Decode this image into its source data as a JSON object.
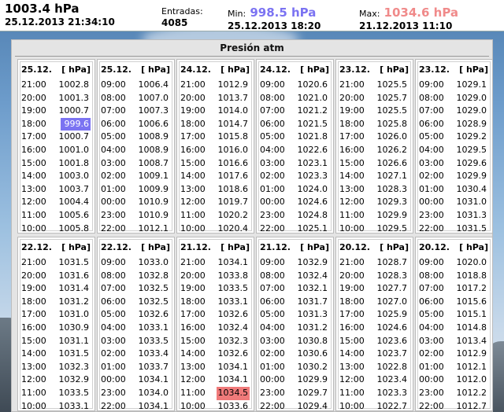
{
  "header": {
    "current_value": "1003.4 hPa",
    "current_date": "25.12.2013 21:34:10",
    "entradas_label": "Entradas:",
    "entradas_count": "4085",
    "min_label": "Min:",
    "min_value": "998.5 hPa",
    "min_date": "25.12.2013 18:20",
    "max_label": "Max:",
    "max_value": "1034.6 hPa",
    "max_date": "21.12.2013 11:10"
  },
  "colors": {
    "min": "#7b73f2",
    "max": "#f07a7a"
  },
  "panel": {
    "title": "Presión atm",
    "days": [
      {
        "date": "25.12.",
        "unit": "[ hPa]",
        "rows": [
          [
            "21:00",
            "1002.8"
          ],
          [
            "20:00",
            "1001.3"
          ],
          [
            "19:00",
            "1000.7"
          ],
          [
            "18:00",
            "999.6",
            "min"
          ],
          [
            "17:00",
            "1000.7"
          ],
          [
            "16:00",
            "1001.0"
          ],
          [
            "15:00",
            "1001.8"
          ],
          [
            "14:00",
            "1003.0"
          ],
          [
            "13:00",
            "1003.7"
          ],
          [
            "12:00",
            "1004.4"
          ],
          [
            "11:00",
            "1005.6"
          ],
          [
            "10:00",
            "1005.8"
          ]
        ]
      },
      {
        "date": "25.12.",
        "unit": "[ hPa]",
        "rows": [
          [
            "09:00",
            "1006.4"
          ],
          [
            "08:00",
            "1007.0"
          ],
          [
            "07:00",
            "1007.3"
          ],
          [
            "06:00",
            "1006.6"
          ],
          [
            "05:00",
            "1008.9"
          ],
          [
            "04:00",
            "1008.9"
          ],
          [
            "03:00",
            "1008.7"
          ],
          [
            "02:00",
            "1009.1"
          ],
          [
            "01:00",
            "1009.9"
          ],
          [
            "00:00",
            "1010.9"
          ],
          [
            "23:00",
            "1010.9"
          ],
          [
            "22:00",
            "1012.1"
          ]
        ]
      },
      {
        "date": "24.12.",
        "unit": "[ hPa]",
        "rows": [
          [
            "21:00",
            "1012.9"
          ],
          [
            "20:00",
            "1013.7"
          ],
          [
            "19:00",
            "1014.0"
          ],
          [
            "18:00",
            "1014.7"
          ],
          [
            "17:00",
            "1015.8"
          ],
          [
            "16:00",
            "1016.0"
          ],
          [
            "15:00",
            "1016.6"
          ],
          [
            "14:00",
            "1017.6"
          ],
          [
            "13:00",
            "1018.6"
          ],
          [
            "12:00",
            "1019.7"
          ],
          [
            "11:00",
            "1020.2"
          ],
          [
            "10:00",
            "1020.4"
          ]
        ]
      },
      {
        "date": "24.12.",
        "unit": "[ hPa]",
        "rows": [
          [
            "09:00",
            "1020.6"
          ],
          [
            "08:00",
            "1021.0"
          ],
          [
            "07:00",
            "1021.2"
          ],
          [
            "06:00",
            "1021.5"
          ],
          [
            "05:00",
            "1021.8"
          ],
          [
            "04:00",
            "1022.6"
          ],
          [
            "03:00",
            "1023.1"
          ],
          [
            "02:00",
            "1023.3"
          ],
          [
            "01:00",
            "1024.0"
          ],
          [
            "00:00",
            "1024.6"
          ],
          [
            "23:00",
            "1024.8"
          ],
          [
            "22:00",
            "1025.1"
          ]
        ]
      },
      {
        "date": "23.12.",
        "unit": "[ hPa]",
        "rows": [
          [
            "21:00",
            "1025.5"
          ],
          [
            "20:00",
            "1025.7"
          ],
          [
            "19:00",
            "1025.5"
          ],
          [
            "18:00",
            "1025.8"
          ],
          [
            "17:00",
            "1026.0"
          ],
          [
            "16:00",
            "1026.2"
          ],
          [
            "15:00",
            "1026.6"
          ],
          [
            "14:00",
            "1027.1"
          ],
          [
            "13:00",
            "1028.3"
          ],
          [
            "12:00",
            "1029.3"
          ],
          [
            "11:00",
            "1029.9"
          ],
          [
            "10:00",
            "1029.5"
          ]
        ]
      },
      {
        "date": "23.12.",
        "unit": "[ hPa]",
        "rows": [
          [
            "09:00",
            "1029.1"
          ],
          [
            "08:00",
            "1029.0"
          ],
          [
            "07:00",
            "1029.0"
          ],
          [
            "06:00",
            "1028.9"
          ],
          [
            "05:00",
            "1029.2"
          ],
          [
            "04:00",
            "1029.5"
          ],
          [
            "03:00",
            "1029.6"
          ],
          [
            "02:00",
            "1029.9"
          ],
          [
            "01:00",
            "1030.4"
          ],
          [
            "00:00",
            "1031.0"
          ],
          [
            "23:00",
            "1031.3"
          ],
          [
            "22:00",
            "1031.5"
          ]
        ]
      },
      {
        "date": "22.12.",
        "unit": "[ hPa]",
        "rows": [
          [
            "21:00",
            "1031.5"
          ],
          [
            "20:00",
            "1031.6"
          ],
          [
            "19:00",
            "1031.4"
          ],
          [
            "18:00",
            "1031.2"
          ],
          [
            "17:00",
            "1031.0"
          ],
          [
            "16:00",
            "1030.9"
          ],
          [
            "15:00",
            "1031.1"
          ],
          [
            "14:00",
            "1031.5"
          ],
          [
            "13:00",
            "1032.3"
          ],
          [
            "12:00",
            "1032.9"
          ],
          [
            "11:00",
            "1033.5"
          ],
          [
            "10:00",
            "1033.1"
          ]
        ]
      },
      {
        "date": "22.12.",
        "unit": "[ hPa]",
        "rows": [
          [
            "09:00",
            "1033.0"
          ],
          [
            "08:00",
            "1032.8"
          ],
          [
            "07:00",
            "1032.5"
          ],
          [
            "06:00",
            "1032.5"
          ],
          [
            "05:00",
            "1032.6"
          ],
          [
            "04:00",
            "1033.1"
          ],
          [
            "03:00",
            "1033.5"
          ],
          [
            "02:00",
            "1033.4"
          ],
          [
            "01:00",
            "1033.7"
          ],
          [
            "00:00",
            "1034.1"
          ],
          [
            "23:00",
            "1034.0"
          ],
          [
            "22:00",
            "1034.1"
          ]
        ]
      },
      {
        "date": "21.12.",
        "unit": "[ hPa]",
        "rows": [
          [
            "21:00",
            "1034.1"
          ],
          [
            "20:00",
            "1033.8"
          ],
          [
            "19:00",
            "1033.5"
          ],
          [
            "18:00",
            "1033.1"
          ],
          [
            "17:00",
            "1032.6"
          ],
          [
            "16:00",
            "1032.4"
          ],
          [
            "15:00",
            "1032.3"
          ],
          [
            "14:00",
            "1032.6"
          ],
          [
            "13:00",
            "1034.1"
          ],
          [
            "12:00",
            "1034.1"
          ],
          [
            "11:00",
            "1034.5",
            "max"
          ],
          [
            "10:00",
            "1033.6"
          ]
        ]
      },
      {
        "date": "21.12.",
        "unit": "[ hPa]",
        "rows": [
          [
            "09:00",
            "1032.9"
          ],
          [
            "08:00",
            "1032.4"
          ],
          [
            "07:00",
            "1032.1"
          ],
          [
            "06:00",
            "1031.7"
          ],
          [
            "05:00",
            "1031.3"
          ],
          [
            "04:00",
            "1031.2"
          ],
          [
            "03:00",
            "1030.8"
          ],
          [
            "02:00",
            "1030.6"
          ],
          [
            "01:00",
            "1030.2"
          ],
          [
            "00:00",
            "1029.9"
          ],
          [
            "23:00",
            "1029.7"
          ],
          [
            "22:00",
            "1029.4"
          ]
        ]
      },
      {
        "date": "20.12.",
        "unit": "[ hPa]",
        "rows": [
          [
            "21:00",
            "1028.7"
          ],
          [
            "20:00",
            "1028.3"
          ],
          [
            "19:00",
            "1027.7"
          ],
          [
            "18:00",
            "1027.0"
          ],
          [
            "17:00",
            "1025.9"
          ],
          [
            "16:00",
            "1024.6"
          ],
          [
            "15:00",
            "1023.6"
          ],
          [
            "14:00",
            "1023.7"
          ],
          [
            "13:00",
            "1022.8"
          ],
          [
            "12:00",
            "1023.4"
          ],
          [
            "11:00",
            "1023.3"
          ],
          [
            "10:00",
            "1022.7"
          ]
        ]
      },
      {
        "date": "20.12.",
        "unit": "[ hPa]",
        "rows": [
          [
            "09:00",
            "1020.0"
          ],
          [
            "08:00",
            "1018.8"
          ],
          [
            "07:00",
            "1017.2"
          ],
          [
            "06:00",
            "1015.6"
          ],
          [
            "05:00",
            "1015.1"
          ],
          [
            "04:00",
            "1014.8"
          ],
          [
            "03:00",
            "1013.4"
          ],
          [
            "02:00",
            "1012.9"
          ],
          [
            "01:00",
            "1012.1"
          ],
          [
            "00:00",
            "1012.0"
          ],
          [
            "23:00",
            "1012.2"
          ],
          [
            "22:00",
            "1012.7"
          ]
        ]
      }
    ]
  }
}
